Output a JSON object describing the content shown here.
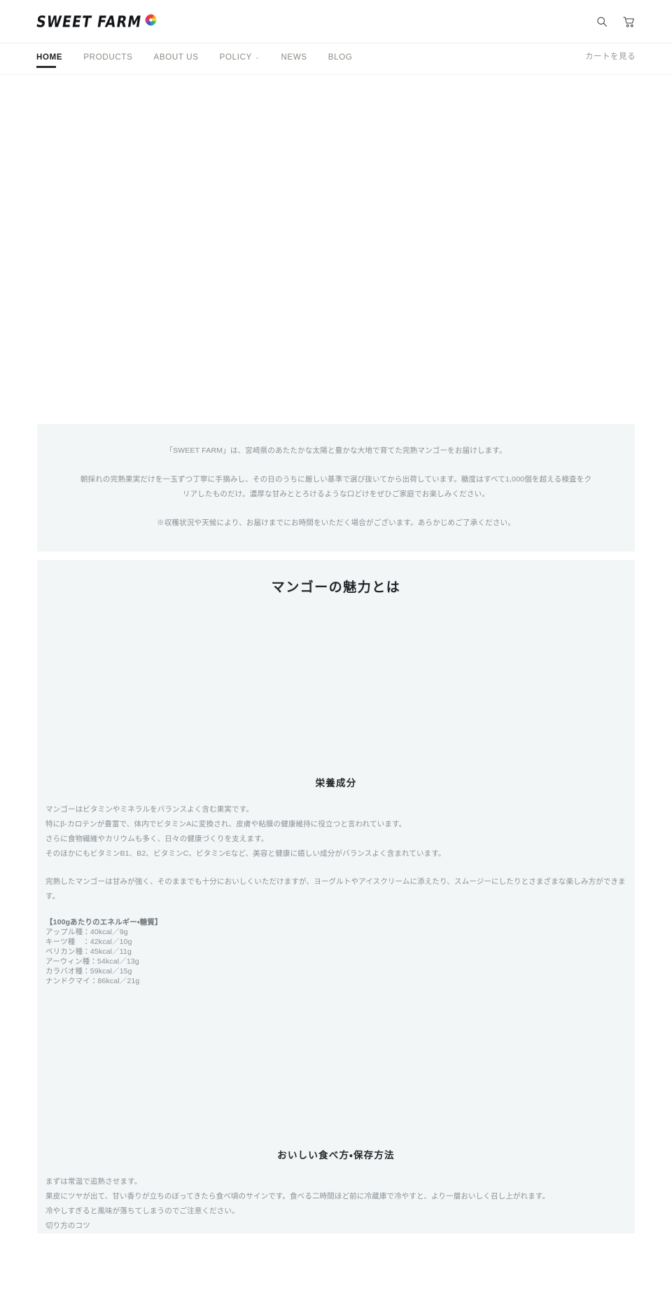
{
  "header": {
    "logo_text": "SWEET FARM",
    "logo_mark": "rainbow-sunburst-icon",
    "search_icon": "search-icon",
    "cart_icon": "cart-icon"
  },
  "nav": {
    "items": [
      {
        "label": "HOME",
        "active": true,
        "has_dropdown": false
      },
      {
        "label": "PRODUCTS",
        "active": false,
        "has_dropdown": false
      },
      {
        "label": "ABOUT US",
        "active": false,
        "has_dropdown": false
      },
      {
        "label": "POLICY",
        "active": false,
        "has_dropdown": true
      },
      {
        "label": "NEWS",
        "active": false,
        "has_dropdown": false
      },
      {
        "label": "BLOG",
        "active": false,
        "has_dropdown": false
      }
    ],
    "caret": "⌄",
    "right_link": "カートを見る"
  },
  "intro": {
    "paragraphs": [
      "「SWEET FARM」は、宮崎県のあたたかな太陽と豊かな大地で育てた完熟マンゴーをお届けします。",
      "朝採れの完熟果実だけを一玉ずつ丁寧に手摘みし、その日のうちに厳しい基準で選び抜いてから出荷しています。糖度はすべて1,000個を超える検査をクリアしたものだけ。濃厚な甘みととろけるような口どけをぜひご家庭でお楽しみください。",
      "※収穫状況や天候により、お届けまでにお時間をいただく場合がございます。あらかじめご了承ください。"
    ]
  },
  "main": {
    "section_title": "マンゴーの魅力とは",
    "sub_title_1": "栄養成分",
    "body_1": [
      "マンゴーはビタミンやミネラルをバランスよく含む果実です。",
      "特にβ-カロテンが豊富で、体内でビタミンAに変換され、皮膚や粘膜の健康維持に役立つと言われています。",
      "さらに食物繊維やカリウムも多く、日々の健康づくりを支えます。",
      "そのほかにもビタミンB1、B2、ビタミンC、ビタミンEなど、美容と健康に嬉しい成分がバランスよく含まれています。"
    ],
    "body_2": "完熟したマンゴーは甘みが強く、そのままでも十分においしくいただけますが、ヨーグルトやアイスクリームに添えたり、スムージーにしたりとさまざまな楽しみ方ができます。",
    "nutrition_heading": "【100gあたりのエネルギー・糖質】",
    "nutrition_rows": [
      {
        "name": "アップル種",
        "kcal": "40kcal",
        "sugar": "9g"
      },
      {
        "name": "キーツ種　",
        "kcal": "42kcal",
        "sugar": "10g"
      },
      {
        "name": "ペリカン種",
        "kcal": "45kcal",
        "sugar": "11g"
      },
      {
        "name": "アーウィン種",
        "kcal": "54kcal",
        "sugar": "13g"
      },
      {
        "name": "カラバオ種",
        "kcal": "59kcal",
        "sugar": "15g"
      },
      {
        "name": "ナンドクマイ",
        "kcal": "86kcal",
        "sugar": "21g"
      }
    ],
    "sub_title_2": "おいしい食べ方・保存方法",
    "body_3": [
      "まずは常温で追熟させます。",
      "果皮にツヤが出て、甘い香りが立ちのぼってきたら食べ頃のサインです。食べる二時間ほど前に冷蔵庫で冷やすと、より一層おいしく召し上がれます。",
      "冷やしすぎると風味が落ちてしまうのでご注意ください。",
      "切り方のコツ"
    ]
  },
  "colors": {
    "panel_bg": "#f3f6f7",
    "page_bg": "#ffffff",
    "body_text": "#8a9094",
    "heading_text": "#24262a",
    "nav_inactive": "#8c8880",
    "nav_active": "#1c1d1f"
  }
}
